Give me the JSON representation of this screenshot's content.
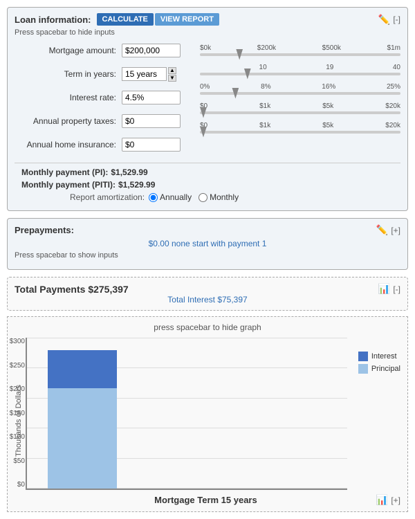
{
  "loan": {
    "section_title": "Loan information:",
    "btn_calculate": "CALCULATE",
    "btn_view_report": "VIEW REPORT",
    "press_spacebar": "Press spacebar to hide inputs",
    "mortgage_label": "Mortgage amount:",
    "mortgage_value": "$200,000",
    "term_label": "Term in years:",
    "term_value": "15 years",
    "rate_label": "Interest rate:",
    "rate_value": "4.5%",
    "tax_label": "Annual property taxes:",
    "tax_value": "$0",
    "insurance_label": "Annual home insurance:",
    "insurance_value": "$0",
    "payment_pi_label": "Monthly payment (PI):",
    "payment_pi_value": "$1,529.99",
    "payment_piti_label": "Monthly payment (PITI):",
    "payment_piti_value": "$1,529.99",
    "amort_label": "Report amortization:",
    "amort_options": [
      "Annually",
      "Monthly"
    ],
    "amort_selected": "Annually",
    "slider_mortgage_labels": [
      "$0k",
      "$200k",
      "$500k",
      "$1m"
    ],
    "slider_term_labels": [
      "",
      "10",
      "19",
      "40"
    ],
    "slider_rate_labels": [
      "0%",
      "8%",
      "16%",
      "25%"
    ],
    "slider_tax_labels": [
      "$0",
      "$1k",
      "$5k",
      "$20k"
    ],
    "slider_insurance_labels": [
      "$0",
      "$1k",
      "$5k",
      "$20k"
    ],
    "mortgage_thumb_pct": 20,
    "term_thumb_pct": 25,
    "rate_thumb_pct": 18,
    "tax_thumb_pct": 0,
    "insurance_thumb_pct": 0
  },
  "prepayments": {
    "title": "Prepayments:",
    "info": "$0.00 none start with payment 1",
    "press_spacebar": "Press spacebar to show inputs"
  },
  "totals": {
    "total_payments_label": "Total Payments $275,397",
    "total_interest_label": "Total Interest $75,397"
  },
  "chart": {
    "press_spacebar": "press spacebar to hide graph",
    "y_axis_label": "Thousands of Dollars",
    "y_labels": [
      "$300",
      "$250",
      "$200",
      "$150",
      "$100",
      "$50",
      "$0"
    ],
    "bar_interest_height": 55,
    "bar_principal_height": 145,
    "bar_total_height": 200,
    "legend_interest": "Interest",
    "legend_principal": "Principal",
    "footer_title": "Mortgage Term 15 years",
    "interest_color": "#4472c4",
    "principal_color": "#9dc3e6"
  }
}
